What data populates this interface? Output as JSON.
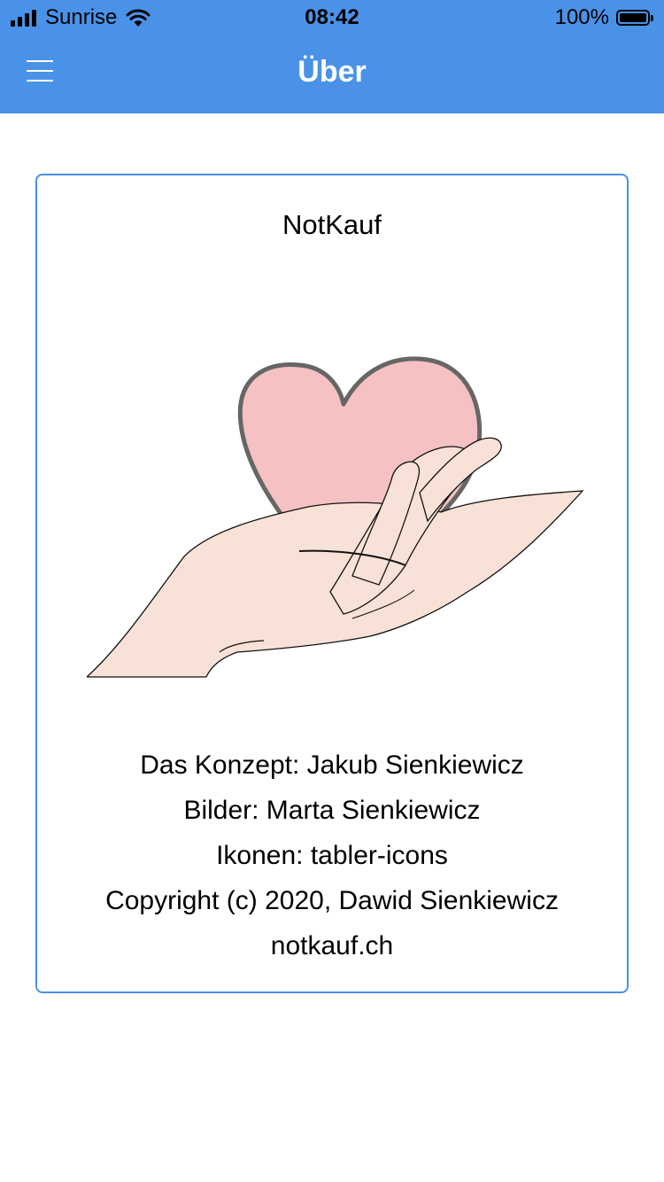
{
  "status_bar": {
    "carrier": "Sunrise",
    "time": "08:42",
    "battery_percent": "100%",
    "battery_level": 1.0,
    "signal_bars": 4,
    "icons": [
      "signal-icon",
      "wifi-icon",
      "battery-icon"
    ]
  },
  "nav": {
    "title": "Über",
    "menu_icon": "hamburger-menu-icon"
  },
  "colors": {
    "accent": "#4a92e8",
    "heart_fill": "#f5c1c2",
    "heart_stroke": "#666666",
    "skin": "#f8e1d6"
  },
  "card": {
    "app_name": "NotKauf",
    "illustration": "hand-holding-heart-image",
    "credits": [
      "Das Konzept: Jakub Sienkiewicz",
      "Bilder: Marta Sienkiewicz",
      "Ikonen: tabler-icons",
      "Copyright (c) 2020, Dawid Sienkiewicz",
      "notkauf.ch"
    ]
  }
}
